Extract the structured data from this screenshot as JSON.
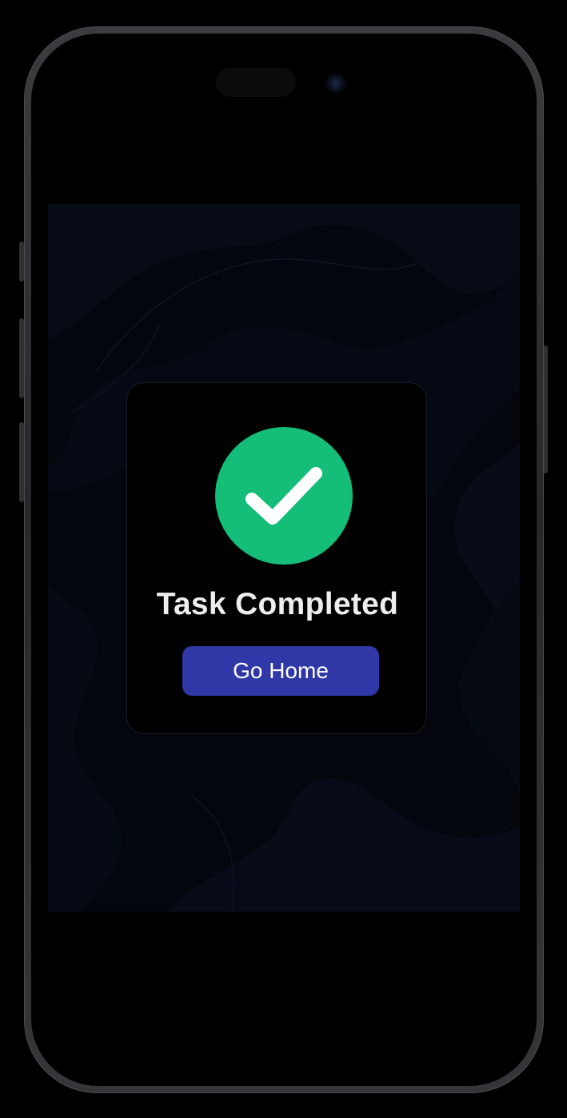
{
  "dialog": {
    "title": "Task Completed",
    "icon": "check-circle-icon",
    "primary_button_label": "Go Home"
  },
  "colors": {
    "success": "#14bd78",
    "primary_button": "#3038a8",
    "card_background": "#000000",
    "screen_background": "#03060d"
  }
}
